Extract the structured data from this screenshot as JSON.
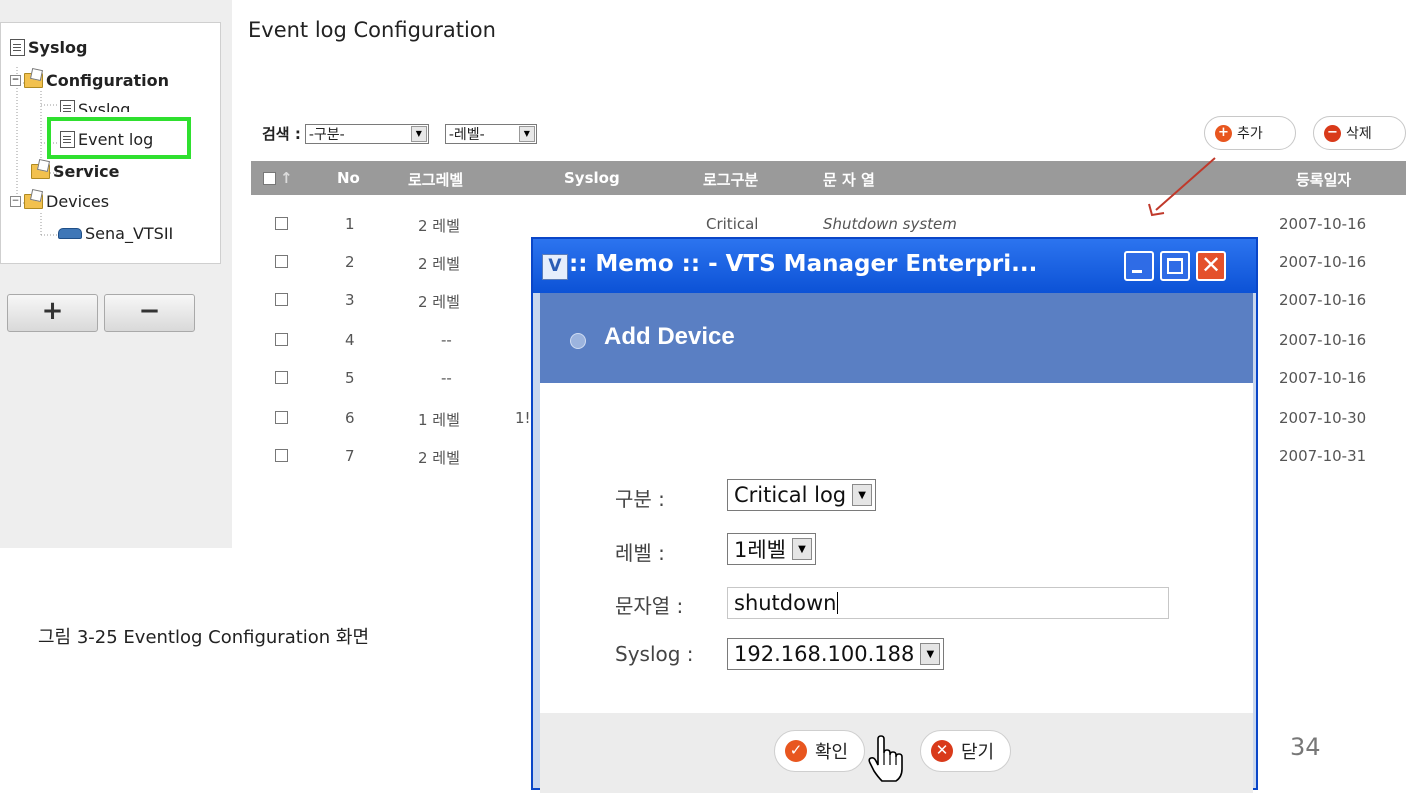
{
  "tree": {
    "root": "Syslog",
    "configuration": "Configuration",
    "syslog_item": "Syslog",
    "eventlog_item": "Event log",
    "service": "Service",
    "devices": "Devices",
    "device_item": "Sena_VTSII",
    "add_label": "+",
    "remove_label": "−"
  },
  "main": {
    "title": "Event log Configuration",
    "search_label": "검색 :",
    "filter_type": "-구분-",
    "filter_level": "-레벨-",
    "add_label": "추가",
    "delete_label": "삭제",
    "columns": [
      "No",
      "로그레벨",
      "Syslog",
      "로그구분",
      "문 자 열",
      "등록일자"
    ],
    "sort_arrow": "↑",
    "rows": [
      {
        "no": "1",
        "level": "2 레벨",
        "syslog": "",
        "type": "Critical",
        "text": "Shutdown system",
        "date": "2007-10-16"
      },
      {
        "no": "2",
        "level": "2 레벨",
        "syslog": "",
        "type": "",
        "text": "",
        "date": "2007-10-16"
      },
      {
        "no": "3",
        "level": "2 레벨",
        "syslog": "",
        "type": "",
        "text": "",
        "date": "2007-10-16"
      },
      {
        "no": "4",
        "level": "--",
        "syslog": "",
        "type": "",
        "text": "",
        "date": "2007-10-16"
      },
      {
        "no": "5",
        "level": "--",
        "syslog": "",
        "type": "",
        "text": "",
        "date": "2007-10-16"
      },
      {
        "no": "6",
        "level": "1 레벨",
        "syslog": "1!",
        "type": "",
        "text": "",
        "date": "2007-10-30"
      },
      {
        "no": "7",
        "level": "2 레벨",
        "syslog": "",
        "type": "",
        "text": "",
        "date": "2007-10-31"
      }
    ]
  },
  "caption": "그림 3-25 Eventlog Configuration 화면",
  "page_number": "34",
  "dialog": {
    "title": ":: Memo :: - VTS Manager Enterpri...",
    "app_icon": "V",
    "heading": "Add Device",
    "type_label": "구분 :",
    "type_value": "Critical log",
    "level_label": "레벨 :",
    "level_value": "1레벨",
    "text_label": "문자열 :",
    "text_value": "shutdown",
    "syslog_label": "Syslog :",
    "syslog_value": "192.168.100.188",
    "ok_label": "확인",
    "close_label": "닫기",
    "close_glyph": "✕"
  },
  "colors": {
    "highlight": "#2fe02f",
    "titlebar": "#0c52d6",
    "banner": "#5a7fc3",
    "add_icon": "#e8561f",
    "delete_icon": "#d93a1a",
    "annotation_arrow": "#c0392b"
  }
}
